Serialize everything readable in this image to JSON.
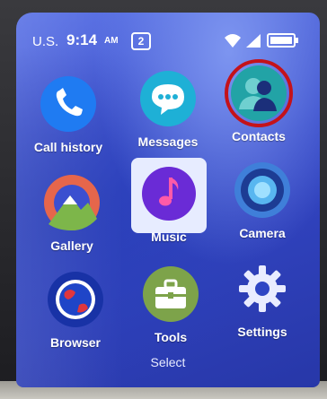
{
  "status_bar": {
    "carrier": "U.S.",
    "time": "9:14",
    "am_pm": "AM",
    "notification_count": "2",
    "icons": [
      "wifi-icon",
      "signal-icon",
      "battery-icon"
    ]
  },
  "apps": [
    {
      "label": "Call history",
      "icon": "phone-icon",
      "selected": false
    },
    {
      "label": "Messages",
      "icon": "chat-bubble-icon",
      "selected": false
    },
    {
      "label": "Contacts",
      "icon": "contacts-icon",
      "selected": true
    },
    {
      "label": "Gallery",
      "icon": "gallery-icon",
      "selected": false
    },
    {
      "label": "Music",
      "icon": "music-note-icon",
      "selected": false
    },
    {
      "label": "Camera",
      "icon": "camera-icon",
      "selected": false
    },
    {
      "label": "Browser",
      "icon": "globe-icon",
      "selected": false
    },
    {
      "label": "Tools",
      "icon": "toolbox-icon",
      "selected": false
    },
    {
      "label": "Settings",
      "icon": "gear-icon",
      "selected": false
    }
  ],
  "softkey": {
    "center_label": "Select"
  },
  "colors": {
    "highlight_ring": "#c4121a",
    "screen_background": "#3447c6"
  }
}
